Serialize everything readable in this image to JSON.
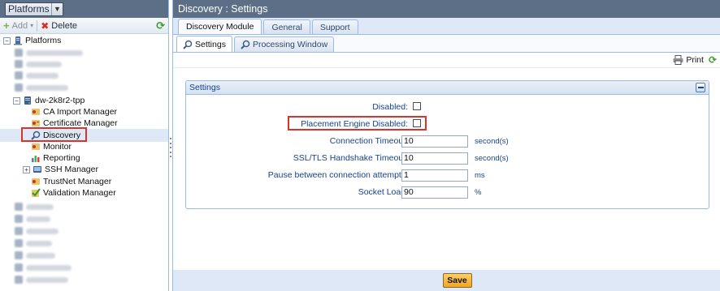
{
  "left": {
    "platform_select": "Platforms",
    "toolbar": {
      "add_label": "Add",
      "delete_label": "Delete"
    },
    "tree": {
      "root_label": "Platforms",
      "server_label": "dw-2k8r2-tpp",
      "modules": [
        "CA Import Manager",
        "Certificate Manager",
        "Discovery",
        "Monitor",
        "Reporting",
        "SSH Manager",
        "TrustNet Manager",
        "Validation Manager"
      ]
    }
  },
  "right": {
    "title": "Discovery : Settings",
    "tabs": [
      "Discovery Module",
      "General",
      "Support"
    ],
    "subtabs": [
      "Settings",
      "Processing Window"
    ],
    "toolbar": {
      "print_label": "Print"
    },
    "fieldset": {
      "title": "Settings",
      "disabled_label": "Disabled:",
      "placement_label": "Placement Engine Disabled:",
      "connection_label": "Connection Timeout:",
      "connection_value": "10",
      "connection_unit": "second(s)",
      "handshake_label": "SSL/TLS Handshake Timeout:",
      "handshake_value": "10",
      "handshake_unit": "second(s)",
      "pause_label": "Pause between connection attempts:",
      "pause_value": "1",
      "pause_unit": "ms",
      "socket_label": "Socket Load:",
      "socket_value": "90",
      "socket_unit": "%"
    },
    "save_label": "Save"
  },
  "colors": {
    "header_bg": "#5c6f86",
    "panel_bg": "#dfe8f6",
    "border": "#99bbe8",
    "label_text": "#15428b",
    "highlight_box": "#d9342b",
    "save_button": "#f2a61f"
  }
}
